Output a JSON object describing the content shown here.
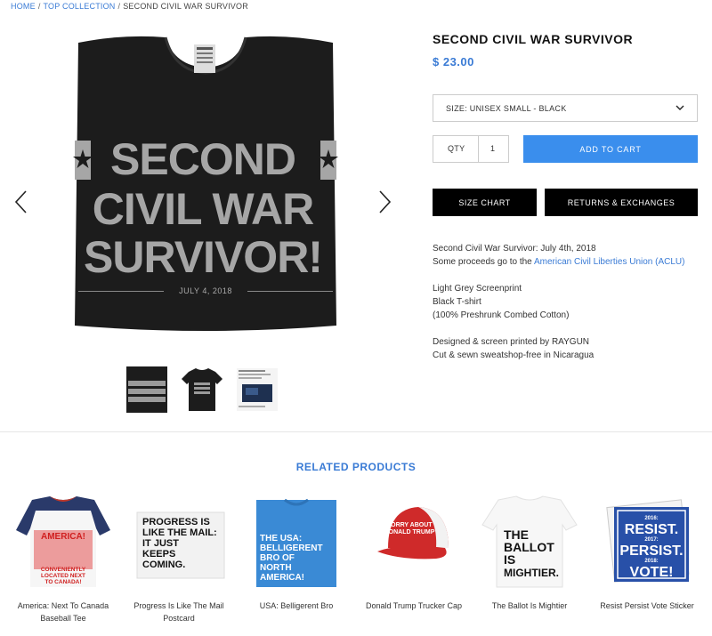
{
  "breadcrumb": {
    "home": "HOME",
    "collection": "TOP COLLECTION",
    "current": "SECOND CIVIL WAR SURVIVOR",
    "separator": "/"
  },
  "gallery": {
    "shirt_lines": [
      "SECOND",
      "CIVIL WAR",
      "SURVIVOR!"
    ],
    "shirt_date": "JULY 4, 2018",
    "thumb_count": 3,
    "icons": {
      "prev": "chevron-left-icon",
      "next": "chevron-right-icon"
    }
  },
  "product": {
    "title": "SECOND CIVIL WAR SURVIVOR",
    "price": "$ 23.00",
    "size_label": "SIZE: UNISEX SMALL - BLACK",
    "qty_label": "QTY",
    "qty_value": "1",
    "add_to_cart": "ADD TO CART",
    "size_chart": "SIZE CHART",
    "returns": "RETURNS & EXCHANGES",
    "desc": {
      "line1": "Second Civil War Survivor: July 4th, 2018",
      "line2_prefix": "Some proceeds go to the ",
      "line2_link": "American Civil Liberties Union (ACLU)",
      "line3": "Light Grey Screenprint",
      "line4": "Black T-shirt",
      "line5": "(100% Preshrunk Combed Cotton)",
      "line6": "Designed & screen printed by RAYGUN",
      "line7": "Cut & sewn sweatshop-free in Nicaragua"
    }
  },
  "related": {
    "title": "RELATED PRODUCTS",
    "items": [
      {
        "name": "America: Next To Canada Baseball Tee",
        "art": [
          "AMERICA!",
          "CONVENIENTLY",
          "LOCATED NEXT",
          "TO CANADA!"
        ]
      },
      {
        "name": "Progress Is Like The Mail Postcard",
        "art": [
          "PROGRESS IS",
          "LIKE THE MAIL:",
          "IT JUST",
          "KEEPS",
          "COMING."
        ]
      },
      {
        "name": "USA: Belligerent Bro",
        "art": [
          "THE USA:",
          "BELLIGERENT",
          "BRO OF",
          "NORTH",
          "AMERICA!"
        ]
      },
      {
        "name": "Donald Trump Trucker Cap",
        "art": [
          "SORRY ABOUT",
          "DONALD TRUMP"
        ]
      },
      {
        "name": "The Ballot Is Mightier",
        "art": [
          "THE",
          "BALLOT",
          "IS",
          "MIGHTIER."
        ]
      },
      {
        "name": "Resist Persist Vote Sticker",
        "art": [
          "2016:",
          "RESIST.",
          "2017:",
          "PERSIST.",
          "2018:",
          "VOTE!"
        ]
      }
    ]
  },
  "colors": {
    "accent": "#3a7bd5",
    "cart_button": "#3a8eed",
    "dark_button": "#000000",
    "shirt": "#1a1a1a",
    "print": "#a6a6a6"
  }
}
